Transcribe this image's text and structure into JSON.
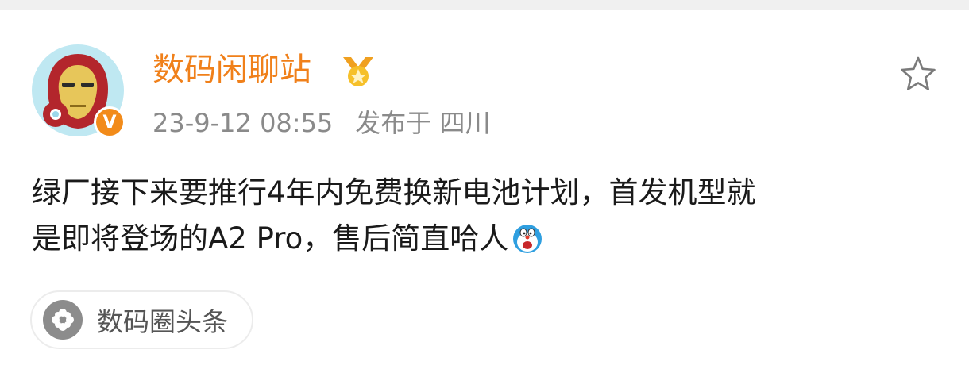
{
  "post": {
    "author": {
      "name": "数码闲聊站",
      "verified_badge": "V",
      "avatar_icon": "iron-man-avatar",
      "medal_icon": "gold-medal-icon"
    },
    "meta": {
      "timestamp": "23-9-12 08:55",
      "location": "发布于 四川"
    },
    "favorite_icon": "star-outline-icon",
    "content": {
      "line1": "绿厂接下来要推行4年内免费换新电池计划，首发机型就",
      "line2": "是即将登场的A2 Pro，售后简直哈人",
      "emoji": "doraemon-shocked-emoji"
    },
    "topic_tag": {
      "label": "数码圈头条",
      "icon": "topic-flower-icon"
    }
  },
  "colors": {
    "author_name": "#f0801a",
    "meta_text": "#8a8a8a",
    "body_text": "#1a1a1a",
    "verified_badge": "#f28b1a"
  }
}
